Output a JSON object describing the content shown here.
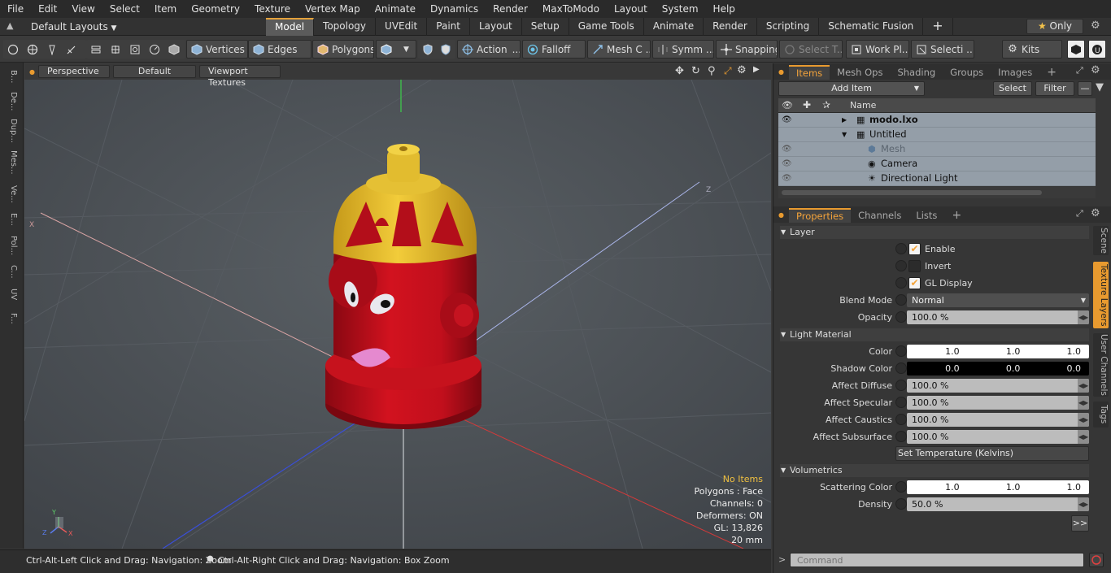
{
  "menu": [
    "File",
    "Edit",
    "View",
    "Select",
    "Item",
    "Geometry",
    "Texture",
    "Vertex Map",
    "Animate",
    "Dynamics",
    "Render",
    "MaxToModo",
    "Layout",
    "System",
    "Help"
  ],
  "layout_selector": "Default Layouts",
  "layout_tabs": [
    "Model",
    "Topology",
    "UVEdit",
    "Paint",
    "Layout",
    "Setup",
    "Game Tools",
    "Animate",
    "Render",
    "Scripting",
    "Schematic Fusion"
  ],
  "active_layout_tab": "Model",
  "only_label": "Only",
  "toolbar": {
    "vertices": "Vertices",
    "edges": "Edges",
    "polygons": "Polygons",
    "action": "Action",
    "falloff": "Falloff",
    "mesh": "Mesh C ...",
    "symm": "Symm ...",
    "snapping": "Snapping",
    "select_t": "Select T...",
    "work_pl": "Work Pl...",
    "selecti": "Selecti ...",
    "kits": "Kits"
  },
  "left_tabs": [
    "B...",
    "De...",
    "Dup...",
    "Mes...",
    "Ve...",
    "E...",
    "Pol...",
    "C...",
    "UV",
    "F..."
  ],
  "viewport": {
    "view_mode": "Perspective",
    "shading": "Default",
    "textures": "Viewport Textures",
    "stats": {
      "no_items": "No Items",
      "polygons": "Polygons : Face",
      "channels": "Channels: 0",
      "deformers": "Deformers: ON",
      "gl": "GL: 13,826",
      "size": "20 mm"
    }
  },
  "status": {
    "hint_left": "Ctrl-Alt-Left Click and Drag: Navigation: Zoom",
    "hint_right": "Ctrl-Alt-Right Click and Drag: Navigation: Box Zoom"
  },
  "items_panel": {
    "tabs": [
      "Items",
      "Mesh Ops",
      "Shading",
      "Groups",
      "Images"
    ],
    "add_item": "Add Item",
    "select": "Select",
    "filter": "Filter",
    "column_name": "Name",
    "tree": [
      {
        "label": "modo.lxo"
      },
      {
        "label": "Untitled"
      },
      {
        "label": "Mesh"
      },
      {
        "label": "Camera"
      },
      {
        "label": "Directional Light"
      }
    ]
  },
  "properties": {
    "tabs": [
      "Properties",
      "Channels",
      "Lists"
    ],
    "layer": {
      "title": "Layer",
      "enable": "Enable",
      "invert": "Invert",
      "gl_display": "GL Display",
      "blend_mode_label": "Blend Mode",
      "blend_mode": "Normal",
      "opacity_label": "Opacity",
      "opacity": "100.0 %"
    },
    "light_material": {
      "title": "Light Material",
      "color_label": "Color",
      "color": [
        "1.0",
        "1.0",
        "1.0"
      ],
      "shadow_label": "Shadow Color",
      "shadow": [
        "0.0",
        "0.0",
        "0.0"
      ],
      "diffuse_label": "Affect Diffuse",
      "diffuse": "100.0 %",
      "specular_label": "Affect Specular",
      "specular": "100.0 %",
      "caustics_label": "Affect Caustics",
      "caustics": "100.0 %",
      "subsurface_label": "Affect Subsurface",
      "subsurface": "100.0 %",
      "temperature": "Set Temperature (Kelvins)"
    },
    "volumetrics": {
      "title": "Volumetrics",
      "scatter_label": "Scattering Color",
      "scatter": [
        "1.0",
        "1.0",
        "1.0"
      ],
      "density_label": "Density",
      "density": "50.0 %"
    }
  },
  "right_tabs": [
    "Scene",
    "Texture Layers",
    "User Channels",
    "Tags"
  ],
  "command_placeholder": "Command",
  "colors": {
    "accent": "#e89a2f",
    "hydrant_red": "#c4101c",
    "hydrant_yellow": "#e8c12f"
  }
}
